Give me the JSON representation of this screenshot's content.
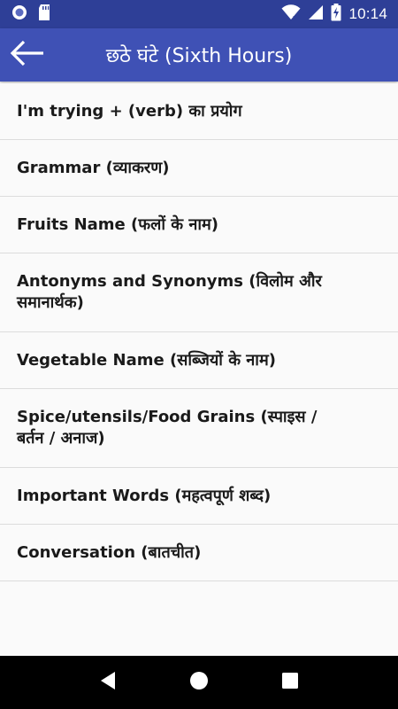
{
  "status_bar": {
    "time": "10:14",
    "icons": [
      "circle-notification-icon",
      "sd-card-icon",
      "wifi-icon",
      "signal-icon",
      "battery-charging-icon"
    ]
  },
  "app_bar": {
    "title": "छठे घंटे (Sixth Hours)",
    "back_icon": "arrow-left-icon"
  },
  "list": {
    "items": [
      {
        "label": "I'm trying + (verb) का प्रयोग"
      },
      {
        "label": "Grammar (व्याकरण)"
      },
      {
        "label": "Fruits Name (फलों के नाम)"
      },
      {
        "label": "Antonyms and Synonyms (विलोम और समानार्थक)"
      },
      {
        "label": "Vegetable Name (सब्जियों के नाम)"
      },
      {
        "label": "Spice/utensils/Food Grains (स्पाइस / बर्तन / अनाज)"
      },
      {
        "label": "Important Words (महत्वपूर्ण शब्द)"
      },
      {
        "label": "Conversation (बातचीत)"
      }
    ]
  },
  "nav_bar": {
    "icons": [
      "back-triangle-icon",
      "home-circle-icon",
      "recents-square-icon"
    ]
  },
  "colors": {
    "status_bar": "#2e3f97",
    "app_bar": "#3f51b5",
    "background": "#fafafa",
    "divider": "#dcdcdc",
    "nav_bar": "#000000"
  }
}
